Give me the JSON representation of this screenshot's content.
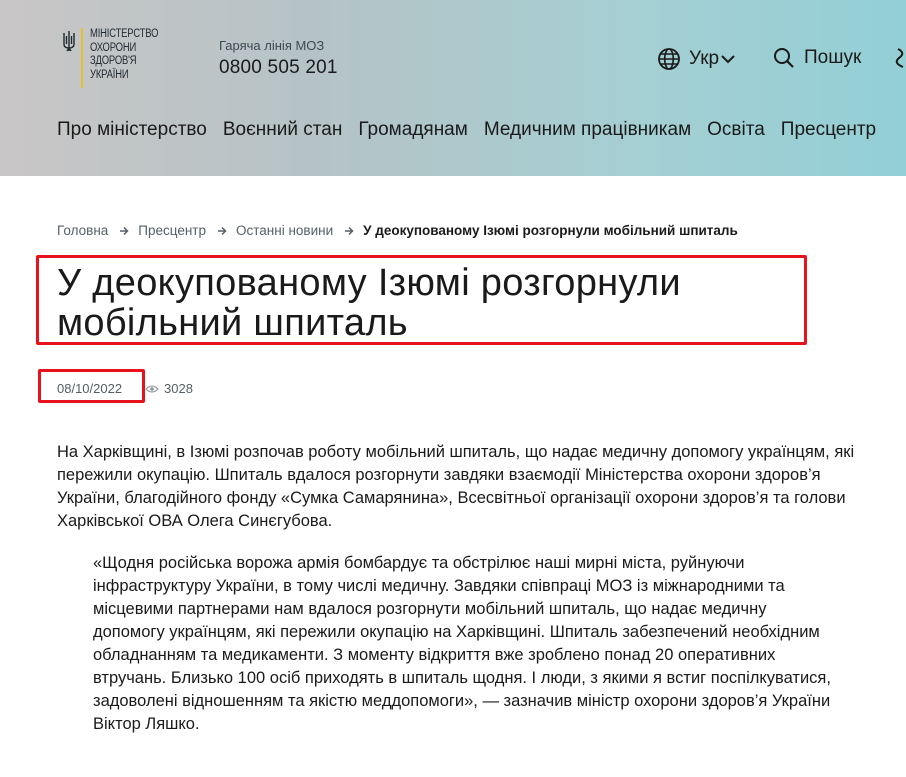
{
  "header": {
    "logo_lines": [
      "Міністерство",
      "охорони",
      "здоров'я",
      "України"
    ],
    "hotline_label": "Гаряча лінія МОЗ",
    "hotline_number": "0800 505 201",
    "language": "Укр",
    "search_label": "Пошук"
  },
  "nav": {
    "items": [
      "Про міністерство",
      "Воєнний стан",
      "Громадянам",
      "Медичним працівникам",
      "Освіта",
      "Пресцентр"
    ]
  },
  "breadcrumb": {
    "items": [
      "Головна",
      "Пресцентр",
      "Останні новини"
    ],
    "current": "У деокупованому Ізюмі розгорнули мобільний шпиталь"
  },
  "article": {
    "title": "У деокупованому Ізюмі розгорнули мобільний шпиталь",
    "date": "08/10/2022",
    "views": "3028",
    "lead": "На Харківщині, в Ізюмі розпочав роботу мобільний шпиталь, що надає медичну допомогу українцям, які пережили окупацію. Шпиталь вдалося розгорнути завдяки взаємодії Міністерства охорони здоров’я України, благодійного фонду «Сумка Самарянина», Всесвітньої організації охорони здоров’я та голови Харківської ОВА Олега Синєгубова.",
    "quote": "«Щодня російська ворожа армія бомбардує та обстрілює наші мирні міста, руйнуючи інфраструктуру України, в тому числі медичну. Завдяки співпраці МОЗ із міжнародними та місцевими партнерами нам вдалося розгорнути мобільний шпиталь, що надає медичну допомогу українцям, які пережили окупацію на Харківщині. Шпиталь забезпечений необхідним обладнанням та медикаменти. З моменту відкриття вже зроблено понад 20 оперативних втручань. Близько 100 осіб приходять в шпиталь щодня. І люди, з якими я встиг поспілкуватися, задоволені відношенням та якістю меддопомоги», — зазначив міністр охорони здоров’я України Віктор Ляшко."
  },
  "icons": {
    "logo": "trident-icon",
    "language": "globe-icon",
    "language_toggle": "chevron-down-icon",
    "search": "search-icon",
    "extra": "accessibility-icon",
    "breadcrumb_separator": "arrow-right-icon",
    "views": "eye-icon"
  },
  "colors": {
    "highlight_border": "#e8121d",
    "logo_accent": "#e8c22d",
    "header_gradient_start": "#c9c6c6",
    "header_gradient_end": "#93cfd6"
  }
}
